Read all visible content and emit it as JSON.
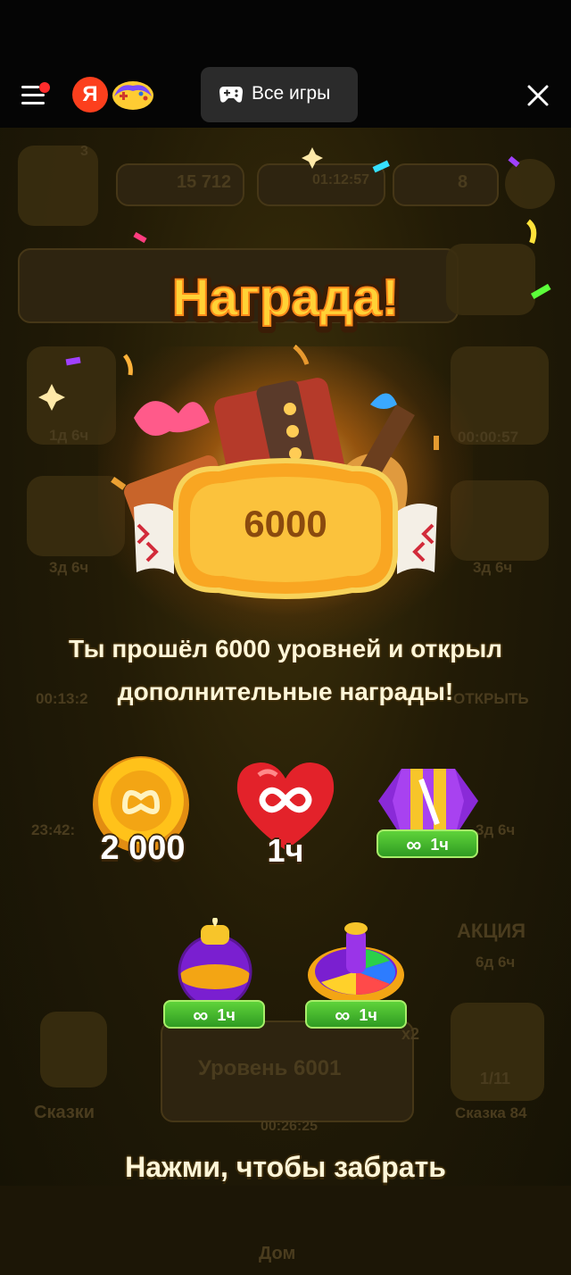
{
  "header": {
    "yandex_logo": "Я",
    "all_games_label": "Все игры",
    "icons": [
      "menu-icon",
      "gamepad-icon",
      "close-icon"
    ]
  },
  "background": {
    "coins": "15 712",
    "lives_timer": "01:12:57",
    "stars": "8",
    "level_badge": "3",
    "offers": [
      "1д 6ч",
      "00:00:57",
      "3д 6ч",
      "3д 6ч",
      "00:13:2",
      "ОТКРЫТЬ",
      "23:42:",
      "3д 6ч",
      "АКЦИЯ",
      "6д 6ч"
    ],
    "level_button": "Уровень 6001",
    "timer": "00:26:25",
    "multiplier": "x2",
    "tales_left": "Сказки",
    "tales_right": "Сказка 84",
    "tale_progress": "1/11",
    "home": "Дом"
  },
  "reward": {
    "title": "Награда!",
    "amount": "6000",
    "description_line1": "Ты прошёл 6000 уровней и открыл",
    "description_line2": "дополнительные награды!",
    "items": [
      {
        "name": "coins",
        "label": "2 000"
      },
      {
        "name": "infinite-lives",
        "label": "1ч"
      },
      {
        "name": "booster-gem",
        "tag_symbol": "∞",
        "tag": "1ч"
      },
      {
        "name": "booster-bomb",
        "tag_symbol": "∞",
        "tag": "1ч"
      },
      {
        "name": "booster-spinner",
        "tag_symbol": "∞",
        "tag": "1ч"
      }
    ],
    "claim_hint": "Нажми, чтобы забрать"
  }
}
